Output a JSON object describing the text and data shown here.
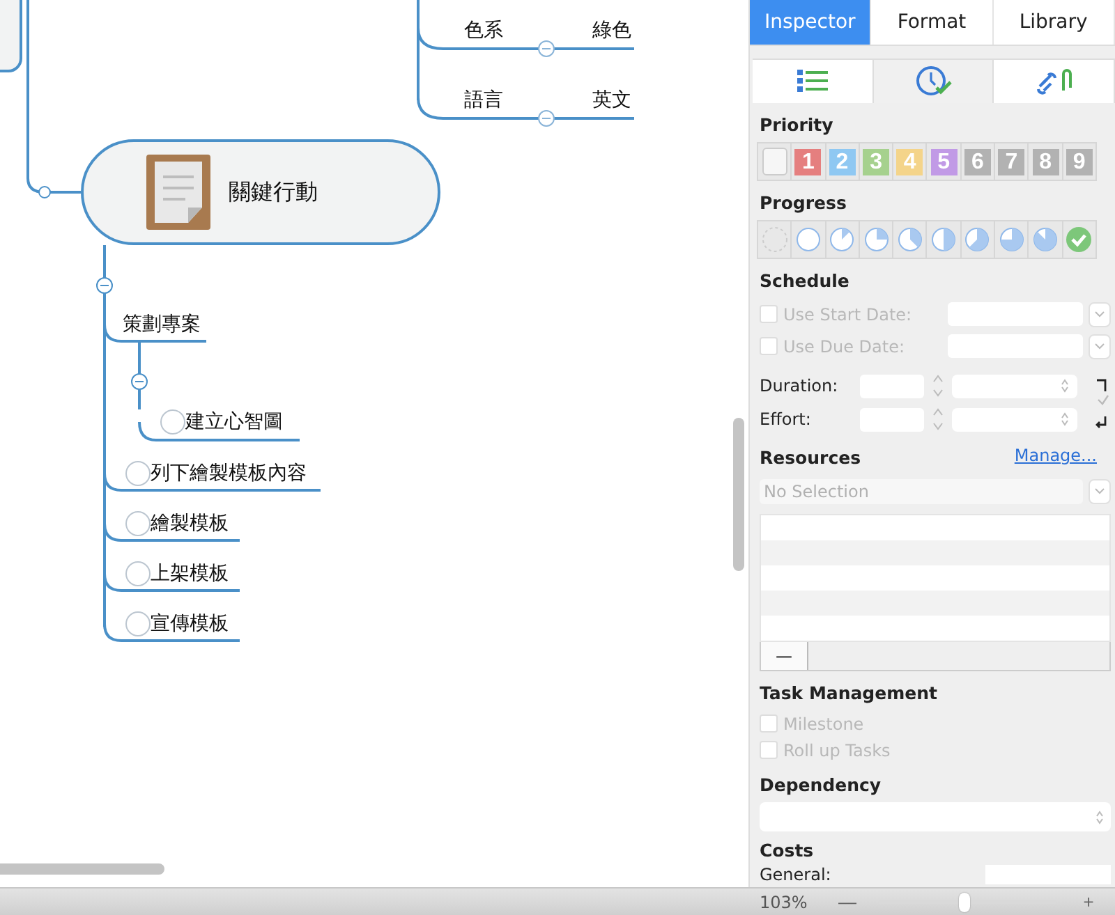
{
  "mindmap": {
    "central": {
      "title": "關鍵行動"
    },
    "attributes": [
      {
        "name": "色系",
        "value": "綠色"
      },
      {
        "name": "語言",
        "value": "英文"
      }
    ],
    "topics": [
      {
        "title": "策劃專案",
        "kind": "topic",
        "children": [
          {
            "title": "建立心智圖",
            "kind": "task",
            "checked": false
          }
        ]
      },
      {
        "title": "列下繪製模板內容",
        "kind": "task",
        "checked": false
      },
      {
        "title": "繪製模板",
        "kind": "task",
        "checked": false
      },
      {
        "title": "上架模板",
        "kind": "task",
        "checked": false
      },
      {
        "title": "宣傳模板",
        "kind": "task",
        "checked": false
      }
    ]
  },
  "tabs": [
    {
      "label": "Inspector",
      "selected": true
    },
    {
      "label": "Format",
      "selected": false
    },
    {
      "label": "Library",
      "selected": false
    }
  ],
  "subtabs": [
    {
      "kind": "list",
      "selected": false
    },
    {
      "kind": "clock",
      "selected": true
    },
    {
      "kind": "link",
      "selected": false
    }
  ],
  "priority": {
    "heading": "Priority",
    "items": [
      {
        "kind": "none"
      },
      {
        "kind": "number",
        "label": "1",
        "color": "#e57f7f"
      },
      {
        "kind": "number",
        "label": "2",
        "color": "#8fc8f2"
      },
      {
        "kind": "number",
        "label": "3",
        "color": "#a6d18e"
      },
      {
        "kind": "number",
        "label": "4",
        "color": "#f4d48a"
      },
      {
        "kind": "number",
        "label": "5",
        "color": "#c19ae6"
      },
      {
        "kind": "number",
        "label": "6",
        "color": "#b2b2b2"
      },
      {
        "kind": "number",
        "label": "7",
        "color": "#b2b2b2"
      },
      {
        "kind": "number",
        "label": "8",
        "color": "#b2b2b2"
      },
      {
        "kind": "number",
        "label": "9",
        "color": "#b2b2b2"
      }
    ]
  },
  "progress": {
    "heading": "Progress",
    "items": [
      {
        "kind": "none"
      },
      {
        "kind": "empty"
      },
      {
        "kind": "one-eighth"
      },
      {
        "kind": "quarter"
      },
      {
        "kind": "three-eighths"
      },
      {
        "kind": "half"
      },
      {
        "kind": "five-eighths"
      },
      {
        "kind": "three-quarters"
      },
      {
        "kind": "seven-eighths"
      },
      {
        "kind": "done"
      }
    ]
  },
  "schedule": {
    "heading": "Schedule",
    "dates": [
      {
        "label": "Use Start Date:",
        "checked": false,
        "disabled": true
      },
      {
        "label": "Use Due Date:",
        "checked": false,
        "disabled": true
      }
    ],
    "amounts": [
      {
        "label": "Duration:"
      },
      {
        "label": "Effort:"
      }
    ]
  },
  "resources": {
    "heading": "Resources",
    "manage_link": "Manage...",
    "dropdown": {
      "placeholder": "No Selection"
    },
    "remove_button": "—"
  },
  "task_management": {
    "heading": "Task Management",
    "options": [
      {
        "label": "Milestone",
        "checked": false,
        "disabled": true
      },
      {
        "label": "Roll up Tasks",
        "checked": false,
        "disabled": true
      }
    ]
  },
  "dependency": {
    "heading": "Dependency"
  },
  "costs": {
    "heading": "Costs",
    "fields": [
      {
        "label": "General:"
      }
    ]
  },
  "status_bar": {
    "zoom": "103%",
    "zoom_out": "—",
    "zoom_in": "+",
    "zoom_slider": {
      "level": 0.48
    }
  }
}
